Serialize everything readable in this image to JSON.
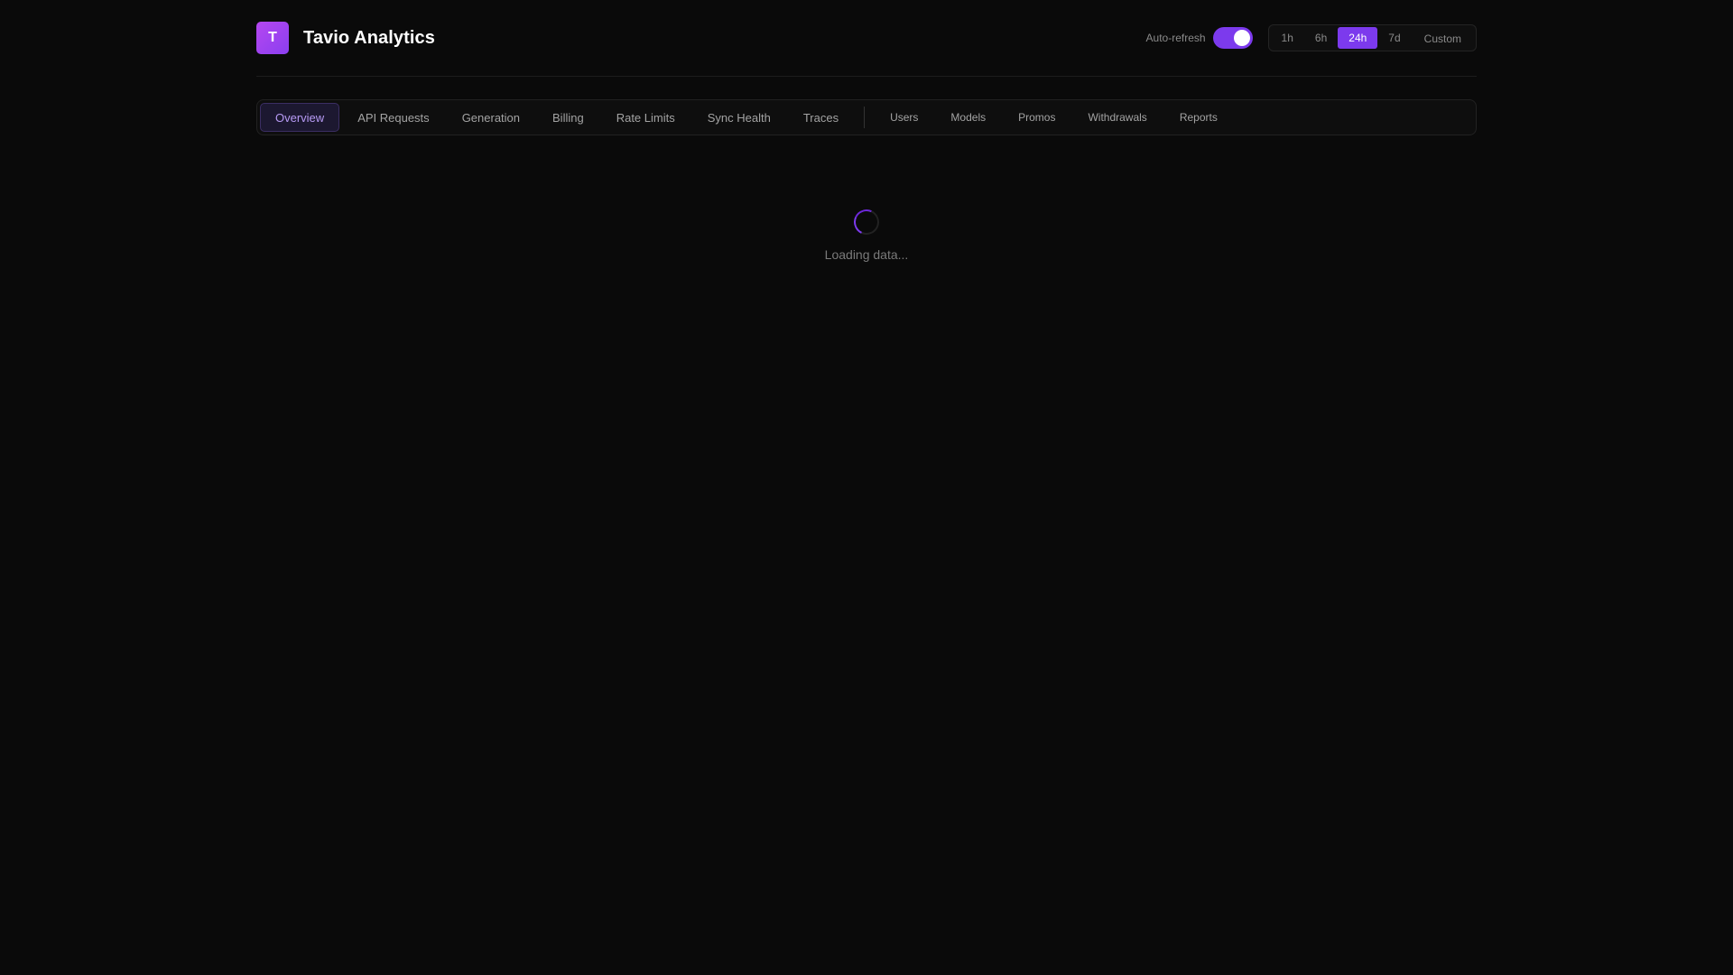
{
  "brand": {
    "logo_letter": "T",
    "title": "Tavio Analytics"
  },
  "header": {
    "autorefresh_label": "Auto-refresh",
    "autorefresh_on": true,
    "ranges": [
      "1h",
      "6h",
      "24h",
      "7d",
      "Custom"
    ],
    "active_range": "24h"
  },
  "nav": {
    "primary_tabs": [
      "Overview",
      "API Requests",
      "Generation",
      "Billing",
      "Rate Limits",
      "Sync Health",
      "Traces"
    ],
    "secondary_tabs": [
      "Users",
      "Models",
      "Promos",
      "Withdrawals",
      "Reports"
    ],
    "active_tab": "Overview"
  },
  "loading": {
    "text": "Loading data..."
  },
  "colors": {
    "accent": "#7c3aed",
    "background": "#0a0a0a"
  }
}
